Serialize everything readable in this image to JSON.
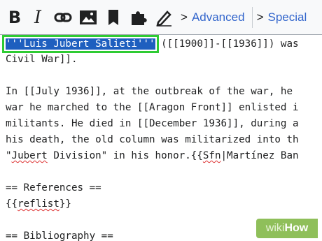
{
  "toolbar": {
    "bold_label": "B",
    "italic_label": "I",
    "icons": [
      "link-icon",
      "image-icon",
      "book-icon",
      "puzzle-icon",
      "signature-icon"
    ],
    "advanced_label": "Advanced",
    "special_label": "Special",
    "chevron": ">",
    "link_color": "#3366cc"
  },
  "editor": {
    "line1": {
      "selected": "'''Luis Jubert Salieti'''",
      "rest": " ([[1900]]-[[1936]]) was"
    },
    "line2": "Civil War]].",
    "line3": "",
    "line4": "In [[July 1936]], at the outbreak of the war, he",
    "line5": "war he marched to the [[Aragon Front]] enlisted i",
    "line6": "militants. He died in [[December 1936]], during a",
    "line7": "his death, the old column was militarized into th",
    "line8": {
      "part1": "\"",
      "word1": "Jubert",
      "part2": " Division\" in his honor.{{",
      "word2": "Sfn",
      "part3": "|Martínez Ban"
    },
    "line9": "",
    "line10": "== References ==",
    "line11": {
      "part1": "{{",
      "word1": "reflist",
      "part2": "}}"
    },
    "line12": "",
    "line13": "== Bibliography =="
  },
  "colors": {
    "selection_bg": "#1e5fbf",
    "selection_outline": "#2ecb33",
    "spell_underline": "#dd3333"
  },
  "watermark": {
    "part1": "wiki",
    "part2": "How"
  }
}
